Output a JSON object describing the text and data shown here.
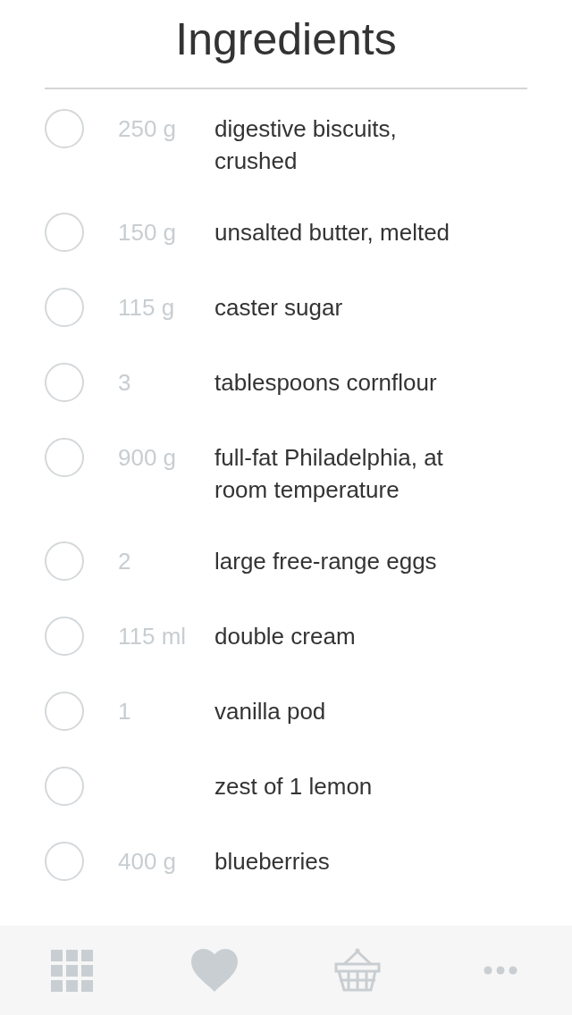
{
  "title": "Ingredients",
  "items": [
    {
      "checked": false,
      "quantity": "250 g",
      "name": "digestive biscuits, crushed"
    },
    {
      "checked": false,
      "quantity": "150 g",
      "name": "unsalted butter, melted"
    },
    {
      "checked": false,
      "quantity": "115 g",
      "name": "caster sugar"
    },
    {
      "checked": false,
      "quantity": "3",
      "name": "tablespoons cornflour"
    },
    {
      "checked": false,
      "quantity": "900 g",
      "name": "full-fat Philadelphia, at room temperature"
    },
    {
      "checked": false,
      "quantity": "2",
      "name": "large free-range eggs"
    },
    {
      "checked": false,
      "quantity": "115 ml",
      "name": "double cream"
    },
    {
      "checked": false,
      "quantity": "1",
      "name": "vanilla pod"
    },
    {
      "checked": false,
      "name": "zest of 1 lemon"
    },
    {
      "checked": false,
      "quantity": "400 g",
      "name": "blueberries"
    }
  ]
}
